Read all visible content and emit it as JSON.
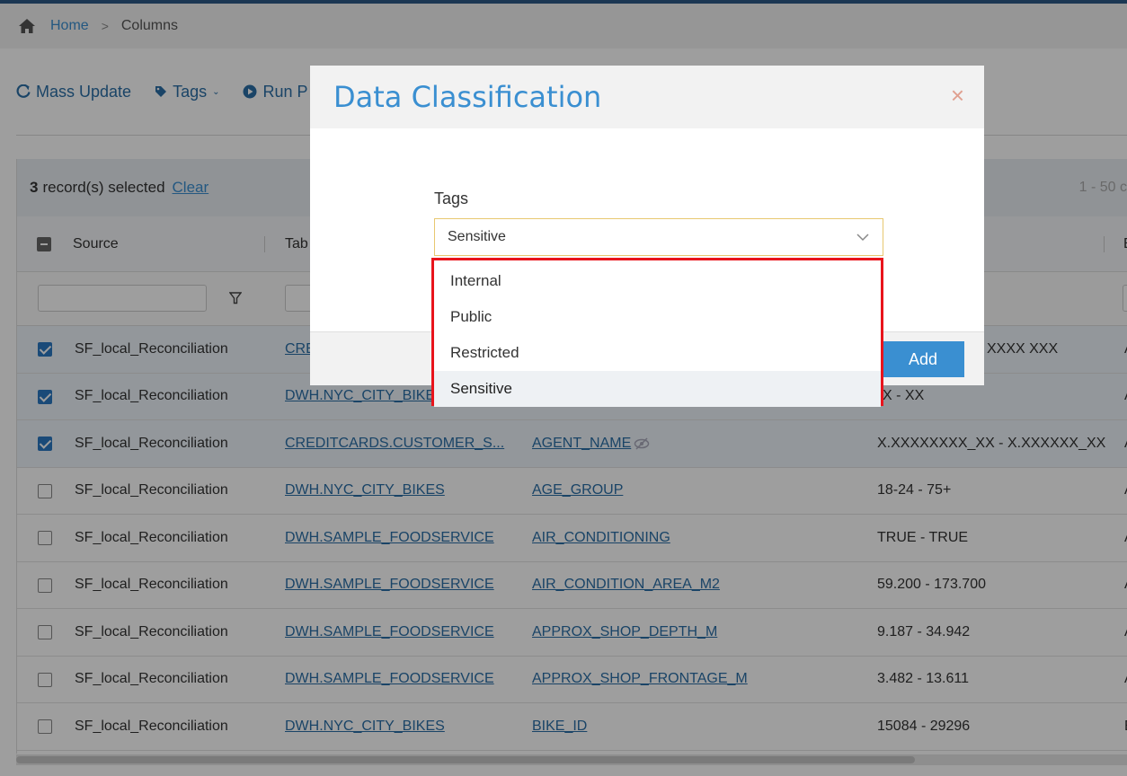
{
  "breadcrumb": {
    "home": "Home",
    "current": "Columns"
  },
  "toolbar": {
    "mass_update": "Mass Update",
    "tags": "Tags",
    "run": "Run P"
  },
  "selection": {
    "count": "3",
    "text": "record(s) selected",
    "clear": "Clear",
    "pager": "1 - 50 c"
  },
  "grid": {
    "headers": {
      "source": "Source",
      "table": "Tab",
      "extra": "E"
    },
    "rows": [
      {
        "checked": true,
        "source": "SF_local_Reconciliation",
        "table": "CRE",
        "column": "",
        "range": "XXXX XXX",
        "extra": "A"
      },
      {
        "checked": true,
        "source": "SF_local_Reconciliation",
        "table": "DWH.NYC_CITY_BIKES",
        "column": "",
        "range": "X - XX",
        "extra": "A"
      },
      {
        "checked": true,
        "source": "SF_local_Reconciliation",
        "table": "CREDITCARDS.CUSTOMER_S...",
        "column": "AGENT_NAME",
        "range": "X.XXXXXXXX_XX - X.XXXXXX_XX",
        "extra": "A"
      },
      {
        "checked": false,
        "source": "SF_local_Reconciliation",
        "table": "DWH.NYC_CITY_BIKES",
        "column": "AGE_GROUP",
        "range": "18-24 - 75+",
        "extra": "A"
      },
      {
        "checked": false,
        "source": "SF_local_Reconciliation",
        "table": "DWH.SAMPLE_FOODSERVICE",
        "column": "AIR_CONDITIONING",
        "range": "TRUE - TRUE",
        "extra": "A"
      },
      {
        "checked": false,
        "source": "SF_local_Reconciliation",
        "table": "DWH.SAMPLE_FOODSERVICE",
        "column": "AIR_CONDITION_AREA_M2",
        "range": "59.200 - 173.700",
        "extra": "A"
      },
      {
        "checked": false,
        "source": "SF_local_Reconciliation",
        "table": "DWH.SAMPLE_FOODSERVICE",
        "column": "APPROX_SHOP_DEPTH_M",
        "range": "9.187 - 34.942",
        "extra": "A"
      },
      {
        "checked": false,
        "source": "SF_local_Reconciliation",
        "table": "DWH.SAMPLE_FOODSERVICE",
        "column": "APPROX_SHOP_FRONTAGE_M",
        "range": "3.482 - 13.611",
        "extra": "A"
      },
      {
        "checked": false,
        "source": "SF_local_Reconciliation",
        "table": "DWH.NYC_CITY_BIKES",
        "column": "BIKE_ID",
        "range": "15084 - 29296",
        "extra": "E"
      }
    ]
  },
  "modal": {
    "title": "Data Classification",
    "close": "×",
    "tags_label": "Tags",
    "selected_value": "Sensitive",
    "options": [
      "Internal",
      "Public",
      "Restricted",
      "Sensitive"
    ],
    "add_button": "Add"
  },
  "colors": {
    "accent": "#3a8fd1",
    "highlight_border": "#e8141c"
  }
}
